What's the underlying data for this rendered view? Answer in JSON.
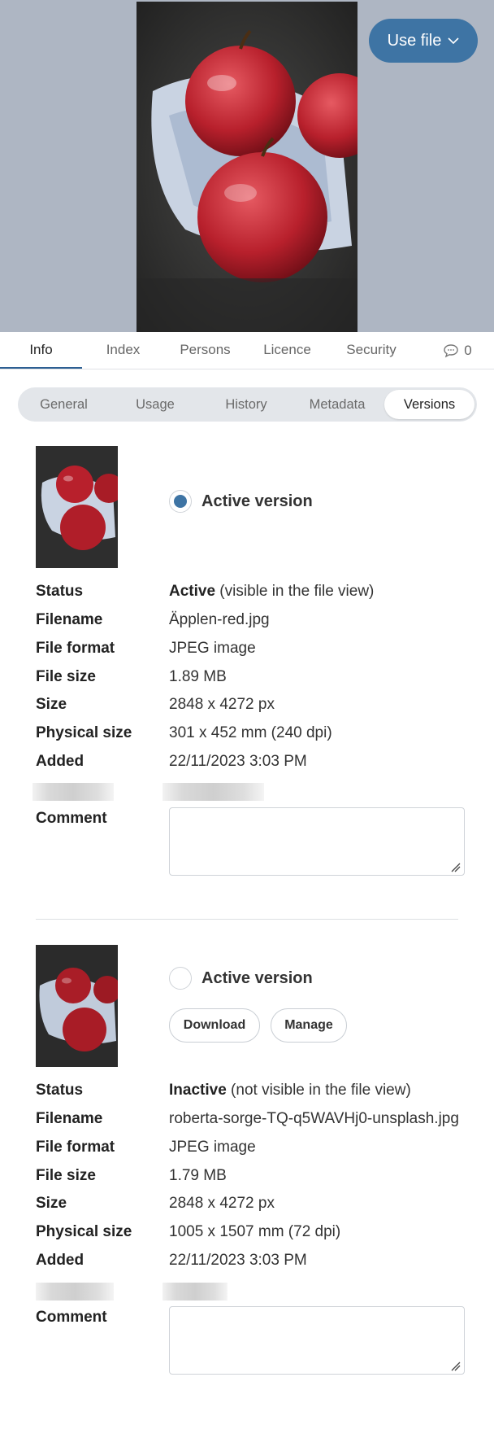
{
  "header": {
    "use_file_label": "Use file"
  },
  "tabs": [
    {
      "label": "Info",
      "active": true
    },
    {
      "label": "Index"
    },
    {
      "label": "Persons"
    },
    {
      "label": "Licence"
    },
    {
      "label": "Security"
    }
  ],
  "comments": {
    "icon": "comment-icon",
    "count": "0"
  },
  "subtabs": [
    {
      "label": "General"
    },
    {
      "label": "Usage"
    },
    {
      "label": "History"
    },
    {
      "label": "Metadata"
    },
    {
      "label": "Versions",
      "active": true
    }
  ],
  "versions": [
    {
      "active": true,
      "active_label": "Active version",
      "status_strong": "Active",
      "status_note": " (visible in the file view)",
      "labels": {
        "status": "Status",
        "filename": "Filename",
        "file_format": "File format",
        "file_size": "File size",
        "size": "Size",
        "physical_size": "Physical size",
        "added": "Added",
        "comment": "Comment"
      },
      "filename": "Äpplen-red.jpg",
      "file_format": "JPEG image",
      "file_size": "1.89 MB",
      "size": "2848 x 4272 px",
      "physical_size": "301 x 452 mm (240 dpi)",
      "added": "22/11/2023 3:03 PM"
    },
    {
      "active": false,
      "active_label": "Active version",
      "download_label": "Download",
      "manage_label": "Manage",
      "status_strong": "Inactive",
      "status_note": " (not visible in the file view)",
      "labels": {
        "status": "Status",
        "filename": "Filename",
        "file_format": "File format",
        "file_size": "File size",
        "size": "Size",
        "physical_size": "Physical size",
        "added": "Added",
        "comment": "Comment"
      },
      "filename": "roberta-sorge-TQ-q5WAVHj0-unsplash.jpg",
      "file_format": "JPEG image",
      "file_size": "1.79 MB",
      "size": "2848 x 4272 px",
      "physical_size": "1005 x 1507 mm (72 dpi)",
      "added": "22/11/2023 3:03 PM"
    }
  ],
  "colors": {
    "accent": "#3e74a4",
    "hero_bg": "#aeb6c3",
    "tab_underline": "#2d5f93"
  }
}
